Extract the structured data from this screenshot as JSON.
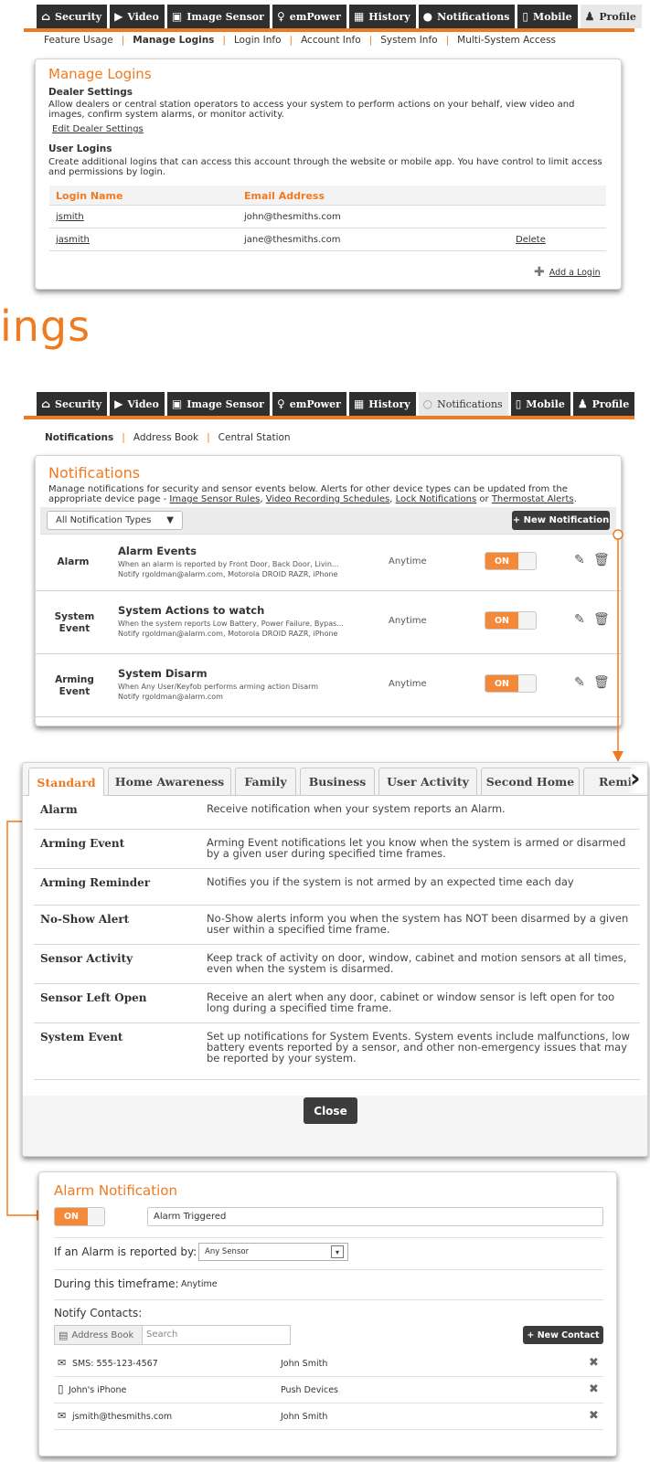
{
  "tabs_top": [
    "Security",
    "Video",
    "Image Sensor",
    "emPower",
    "History",
    "Notifications",
    "Mobile",
    "Profile"
  ],
  "tab_icons": [
    "home-icon",
    "play-icon",
    "image-sensor-icon",
    "bulb-icon",
    "calendar-icon",
    "chat-bubble-icon",
    "phone-icon",
    "person-icon"
  ],
  "profile_subnav": [
    "Feature Usage",
    "Manage Logins",
    "Login Info",
    "Account Info",
    "System Info",
    "Multi-System Access"
  ],
  "manage_logins": {
    "title": "Manage Logins",
    "dealer_heading": "Dealer Settings",
    "dealer_desc": "Allow dealers or central station operators to access your system to perform actions on your behalf, view video and images, confirm system alarms, or monitor activity.",
    "edit_dealer": "Edit Dealer Settings",
    "user_heading": "User Logins",
    "user_desc": "Create additional logins that can access this account through the website or mobile app. You have control to limit access and permissions by login.",
    "col_login": "Login Name",
    "col_email": "Email Address",
    "rows": [
      {
        "login": "jsmith",
        "email": "john@thesmiths.com",
        "action": ""
      },
      {
        "login": "jasmith",
        "email": "jane@thesmiths.com",
        "action": "Delete"
      }
    ],
    "add_login": "Add a Login"
  },
  "big_text": "ings",
  "notif_subnav": [
    "Notifications",
    "Address Book",
    "Central Station"
  ],
  "notifications": {
    "title": "Notifications",
    "desc_plain": "Manage notifications for security and sensor events below. Alerts for other device types can be updated from the appropriate device page - ",
    "link1": "Image Sensor Rules",
    "link2": "Video Recording Schedules",
    "link3": "Lock Notifications",
    "or": " or ",
    "link4": "Thermostat Alerts",
    "filter": "All Notification Types",
    "new_button": "+ New Notification",
    "rows": [
      {
        "type": "Alarm",
        "name": "Alarm Events",
        "line1": "When an alarm is reported by Front Door, Back Door, Livin...",
        "line2": "Notify rgoldman@alarm.com, Motorola DROID RAZR, iPhone",
        "time": "Anytime",
        "toggle": "ON"
      },
      {
        "type": "System Event",
        "name": "System Actions to watch",
        "line1": "When the system reports Low Battery, Power Failure, Bypas...",
        "line2": "Notify rgoldman@alarm.com, Motorola DROID RAZR, iPhone",
        "time": "Anytime",
        "toggle": "ON"
      },
      {
        "type": "Arming Event",
        "name": "System Disarm",
        "line1": "When Any User/Keyfob performs arming action Disarm",
        "line2": "Notify rgoldman@alarm.com",
        "time": "Anytime",
        "toggle": "ON"
      }
    ]
  },
  "dialog": {
    "tabs": [
      "Standard",
      "Home Awareness",
      "Family",
      "Business",
      "User Activity",
      "Second Home",
      "Remi"
    ],
    "items": [
      {
        "name": "Alarm",
        "desc": "Receive notification when your system reports an Alarm."
      },
      {
        "name": "Arming Event",
        "desc": "Arming Event notifications let you know when the system is armed or disarmed by a given user during specified time frames."
      },
      {
        "name": "Arming Reminder",
        "desc": "Notifies you if the system is not armed by an expected time each day"
      },
      {
        "name": "No-Show Alert",
        "desc": "No-Show alerts inform you when the system has NOT been disarmed by a given user within a specified time frame."
      },
      {
        "name": "Sensor Activity",
        "desc": "Keep track of activity on door, window, cabinet and motion sensors at all times, even when the system is disarmed."
      },
      {
        "name": "Sensor Left Open",
        "desc": "Receive an alert when any door, cabinet or window sensor is left open for too long during a specified time frame."
      },
      {
        "name": "System Event",
        "desc": "Set up notifications for System Events. System events include malfunctions, low battery events reported by a sensor, and other non-emergency issues that may be reported by your system."
      }
    ],
    "close": "Close"
  },
  "alarm_notification": {
    "title": "Alarm Notification",
    "toggle": "ON",
    "name_value": "Alarm Triggered",
    "reported_label": "If an Alarm is reported by:",
    "reported_value": "Any Sensor",
    "timeframe_label": "During this timeframe:",
    "timeframe_value": "Anytime",
    "contacts_label": "Notify Contacts:",
    "address_book": "Address Book",
    "search_placeholder": "Search",
    "new_contact": "+ New Contact",
    "contacts": [
      {
        "icon": "envelope-icon",
        "device": "SMS: 555-123-4567",
        "name": "John Smith"
      },
      {
        "icon": "phone-icon",
        "device": "John's iPhone",
        "name": "Push Devices"
      },
      {
        "icon": "mail-outline-icon",
        "device": "jsmith@thesmiths.com",
        "name": "John Smith"
      }
    ]
  },
  "colors": {
    "accent": "#f07a1f",
    "dark": "#2f2f2f"
  }
}
